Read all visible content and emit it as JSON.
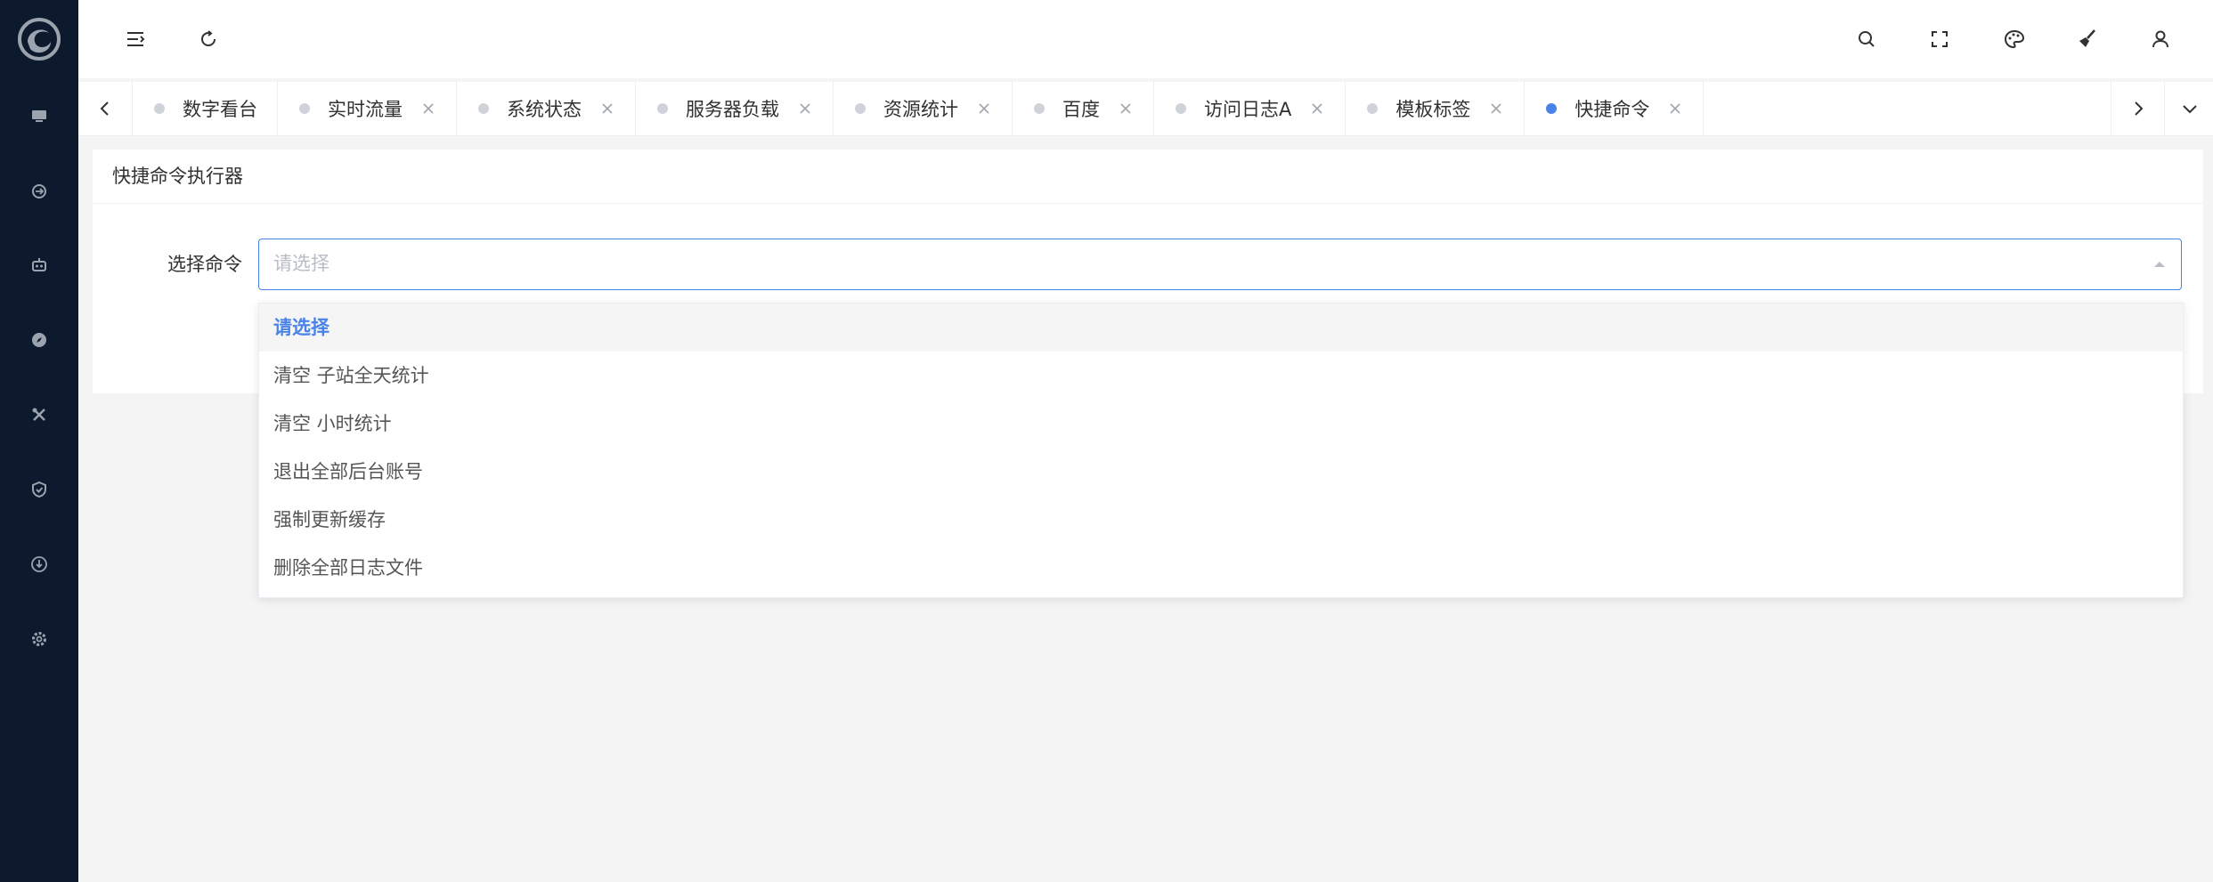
{
  "sidebar": {
    "background": "#0d1a2d",
    "logo_icon": "swirl-logo-icon",
    "items": [
      {
        "icon": "monitor-icon"
      },
      {
        "icon": "exchange-icon"
      },
      {
        "icon": "robot-icon"
      },
      {
        "icon": "compass-icon"
      },
      {
        "icon": "tools-icon"
      },
      {
        "icon": "shield-check-icon"
      },
      {
        "icon": "download-icon"
      },
      {
        "icon": "gear-icon"
      }
    ]
  },
  "header": {
    "left_icons": [
      "menu-fold-icon",
      "refresh-icon"
    ],
    "right_icons": [
      "search-icon",
      "fullscreen-icon",
      "palette-icon",
      "brush-icon",
      "user-icon"
    ]
  },
  "tabs": {
    "items": [
      {
        "label": "数字看台",
        "closable": false,
        "active": false
      },
      {
        "label": "实时流量",
        "closable": true,
        "active": false
      },
      {
        "label": "系统状态",
        "closable": true,
        "active": false
      },
      {
        "label": "服务器负载",
        "closable": true,
        "active": false
      },
      {
        "label": "资源统计",
        "closable": true,
        "active": false
      },
      {
        "label": "百度",
        "closable": true,
        "active": false
      },
      {
        "label": "访问日志A",
        "closable": true,
        "active": false
      },
      {
        "label": "模板标签",
        "closable": true,
        "active": false
      },
      {
        "label": "快捷命令",
        "closable": true,
        "active": true
      }
    ],
    "active_color": "#4a83e8"
  },
  "card": {
    "title": "快捷命令执行器",
    "form_label": "选择命令",
    "select_placeholder": "请选择"
  },
  "dropdown": {
    "options": [
      {
        "label": "请选择",
        "selected": true
      },
      {
        "label": "清空 子站全天统计",
        "selected": false
      },
      {
        "label": "清空 小时统计",
        "selected": false
      },
      {
        "label": "退出全部后台账号",
        "selected": false
      },
      {
        "label": "强制更新缓存",
        "selected": false
      },
      {
        "label": "删除全部日志文件",
        "selected": false
      }
    ]
  }
}
